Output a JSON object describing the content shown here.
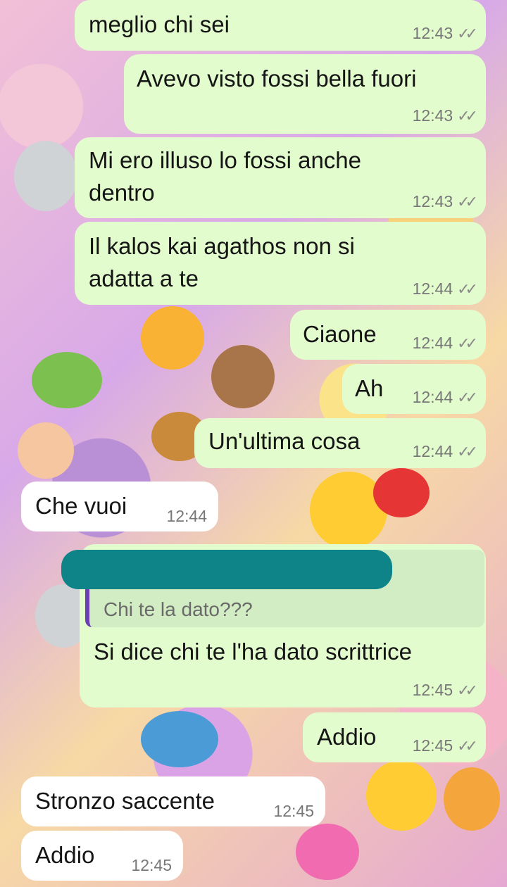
{
  "messages": [
    {
      "text": "meglio chi sei",
      "time": "12:43",
      "dir": "out"
    },
    {
      "text": "Avevo visto fossi bella fuori",
      "time": "12:43",
      "dir": "out"
    },
    {
      "text": "Mi ero illuso lo fossi anche dentro",
      "time": "12:43",
      "dir": "out"
    },
    {
      "text": "Il kalos kai agathos non si adatta a te",
      "time": "12:44",
      "dir": "out"
    },
    {
      "text": "Ciaone",
      "time": "12:44",
      "dir": "out"
    },
    {
      "text": "Ah",
      "time": "12:44",
      "dir": "out"
    },
    {
      "text": "Un'ultima cosa",
      "time": "12:44",
      "dir": "out"
    },
    {
      "text": "Che vuoi",
      "time": "12:44",
      "dir": "in"
    },
    {
      "text": "Si dice chi te l'ha dato scrittrice",
      "time": "12:45",
      "dir": "out",
      "quote": "Chi te la dato???"
    },
    {
      "text": "Addio",
      "time": "12:45",
      "dir": "out"
    },
    {
      "text": "Stronzo saccente",
      "time": "12:45",
      "dir": "in"
    },
    {
      "text": "Addio",
      "time": "12:45",
      "dir": "in"
    }
  ],
  "ticks": "✓✓"
}
